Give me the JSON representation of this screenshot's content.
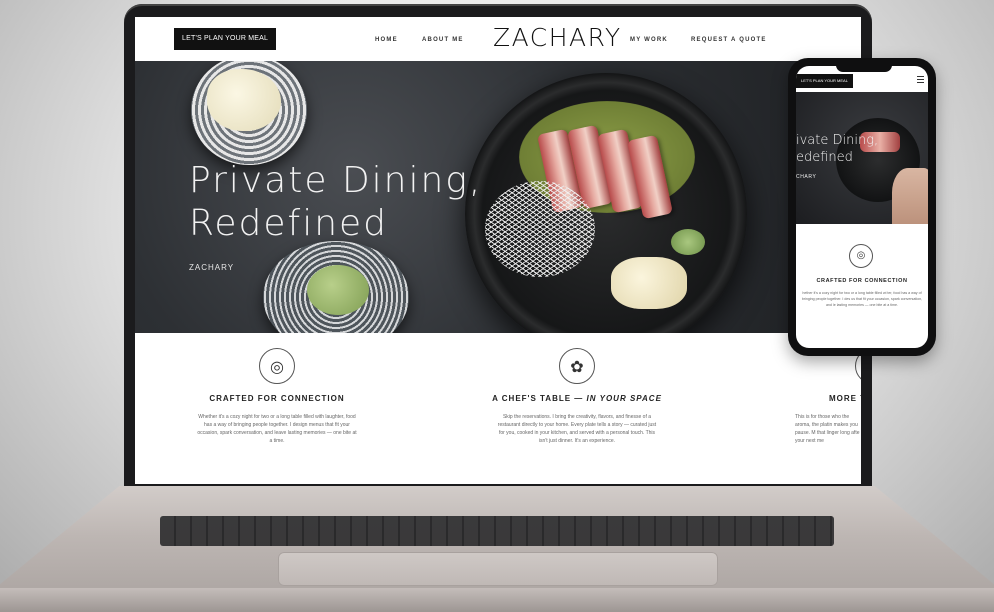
{
  "nav": {
    "cta": "LET'S PLAN YOUR MEAL",
    "brand": "ZACHARY",
    "links": [
      "HOME",
      "ABOUT ME",
      "MY WORK",
      "REQUEST A QUOTE"
    ]
  },
  "hero": {
    "title": "Private Dining,\nRedefined",
    "subtitle": "ZACHARY"
  },
  "features": [
    {
      "icon": "plate-icon",
      "title": "CRAFTED FOR CONNECTION",
      "text": "Whether it's a cozy night for two or a long table filled with laughter, food has a way of bringing people together. I design menus that fit your occasion, spark conversation, and leave lasting memories — one bite at a time."
    },
    {
      "icon": "flower-icon",
      "title_main": "A CHEF'S TABLE — ",
      "title_em": "IN YOUR SPACE",
      "text": "Skip the reservations. I bring the creativity, flavors, and finesse of a restaurant directly to your home. Every plate tells a story — curated just for you, cooked in your kitchen, and served with a personal touch. This isn't just dinner. It's an experience."
    },
    {
      "icon": "dish-icon",
      "title": "MORE T",
      "text": "This is for those who the aroma, the platin makes you pause. M that linger long afte your next me"
    }
  ],
  "phone": {
    "cta": "LET'S PLAN YOUR MEAL",
    "hero_title": "ivate Dining,\nedefined",
    "hero_sub": "CHARY",
    "feature_title": "CRAFTED FOR CONNECTION",
    "feature_text": "hether it's a cozy night for two or a long table filled wi ter, food has a way of bringing people together. I des us that fit your occasion, spark conversation, and le lasting memories — one bite at a time."
  }
}
